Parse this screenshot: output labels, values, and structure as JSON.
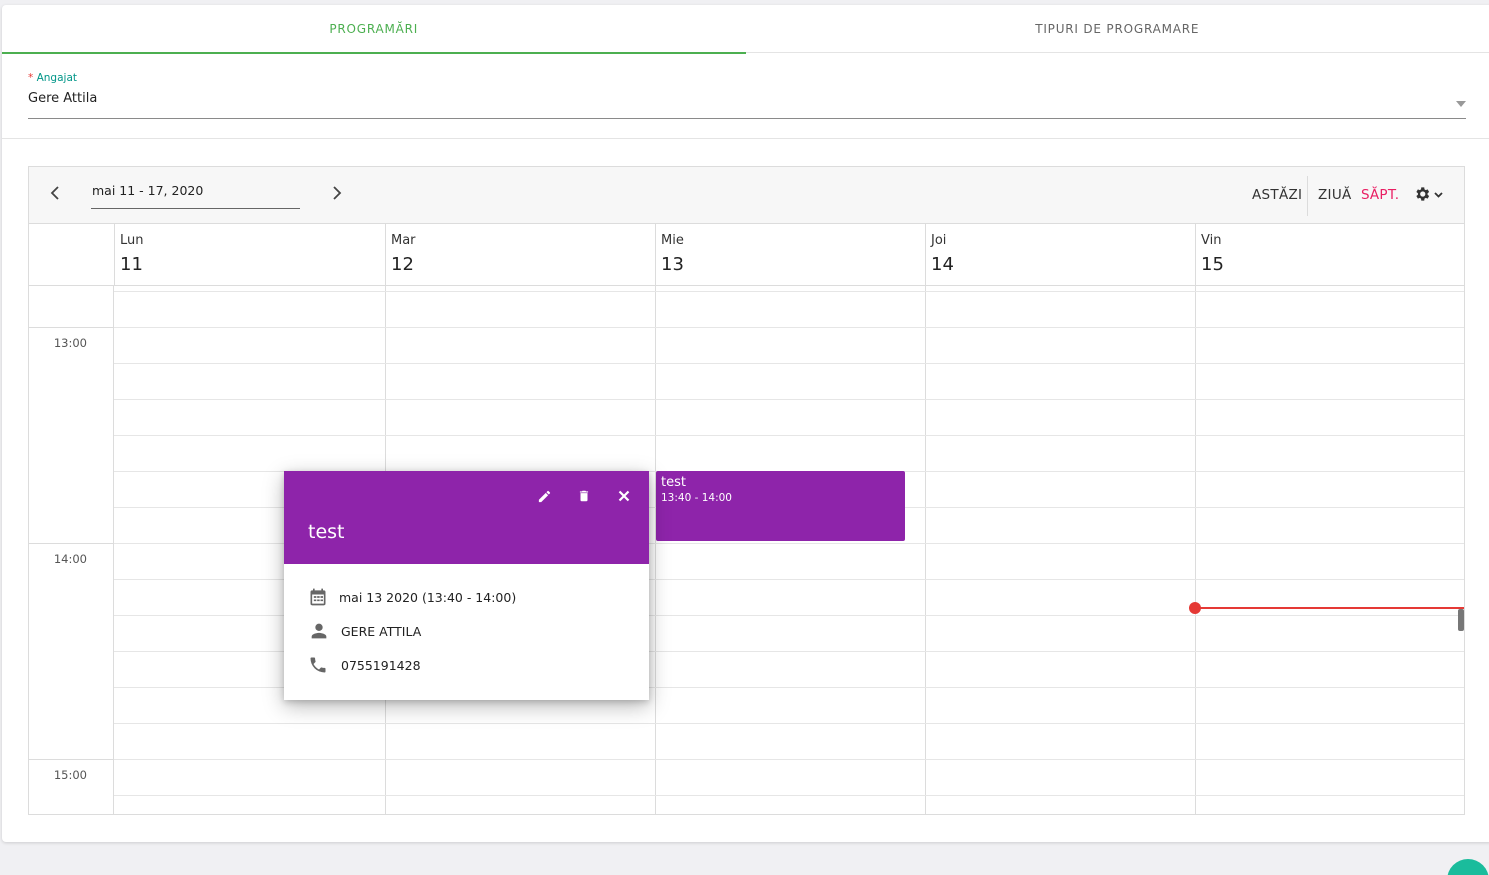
{
  "tabs": [
    {
      "label": "PROGRAMĂRI",
      "active": true
    },
    {
      "label": "TIPURI DE PROGRAMARE",
      "active": false
    }
  ],
  "employee_field": {
    "required_mark": "*",
    "label": "Angajat",
    "value": "Gere Attila"
  },
  "scheduler": {
    "prev_icon": "chevron-left-icon",
    "next_icon": "chevron-right-icon",
    "date_range": "mai 11 - 17, 2020",
    "today_label": "ASTĂZI",
    "day_view_label": "ZIUĂ",
    "week_view_label": "SĂPT.",
    "selected_view": "week",
    "settings_icon": "gear-icon",
    "days": [
      {
        "name": "Lun",
        "number": "11"
      },
      {
        "name": "Mar",
        "number": "12"
      },
      {
        "name": "Mie",
        "number": "13"
      },
      {
        "name": "Joi",
        "number": "14"
      },
      {
        "name": "Vin",
        "number": "15"
      }
    ],
    "time_labels": [
      "13:00",
      "14:00",
      "15:00"
    ],
    "event": {
      "title": "test",
      "time": "13:40 - 14:00",
      "color": "#8e24aa"
    }
  },
  "popup": {
    "title": "test",
    "edit_icon": "pencil-icon",
    "delete_icon": "trash-icon",
    "close_icon": "close-icon",
    "date_text": "mai 13 2020 (13:40 - 14:00)",
    "person_text": "GERE ATTILA",
    "phone_text": "0755191428"
  },
  "colors": {
    "accent_green": "#4caf50",
    "event_purple": "#8e24aa",
    "now_indicator": "#e53935",
    "selected_view": "#e91e63",
    "label_teal": "#009688"
  }
}
